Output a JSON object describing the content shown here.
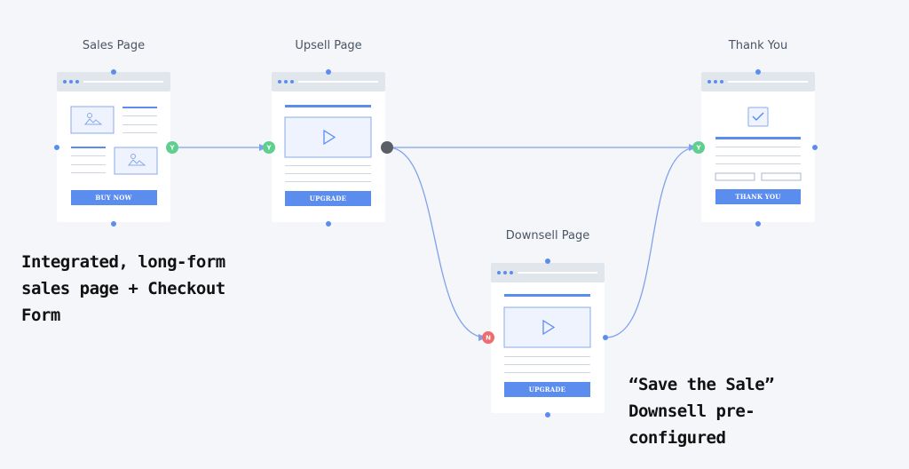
{
  "steps": {
    "sales": {
      "title": "Sales Page",
      "button": "BUY NOW"
    },
    "upsell": {
      "title": "Upsell Page",
      "button": "UPGRADE"
    },
    "thankyou": {
      "title": "Thank You",
      "button": "THANK YOU"
    },
    "downsell": {
      "title": "Downsell Page",
      "button": "UPGRADE"
    }
  },
  "ports": {
    "yes": "Y",
    "no": "N"
  },
  "notes": {
    "left": [
      "Integrated, long-form",
      "sales page + Checkout",
      "Form"
    ],
    "right": [
      "“Save the Sale”",
      "Downsell pre-",
      "configured"
    ]
  },
  "colors": {
    "background": "#f4f6fa",
    "card": "#ffffff",
    "card_header": "#e1e5ec",
    "accent": "#5b8def",
    "line": "#7fa2ea",
    "yes_port": "#5fcf8e",
    "no_port": "#ee6c6c",
    "neutral_port": "#5b5f66",
    "dot": "#5b8def"
  }
}
